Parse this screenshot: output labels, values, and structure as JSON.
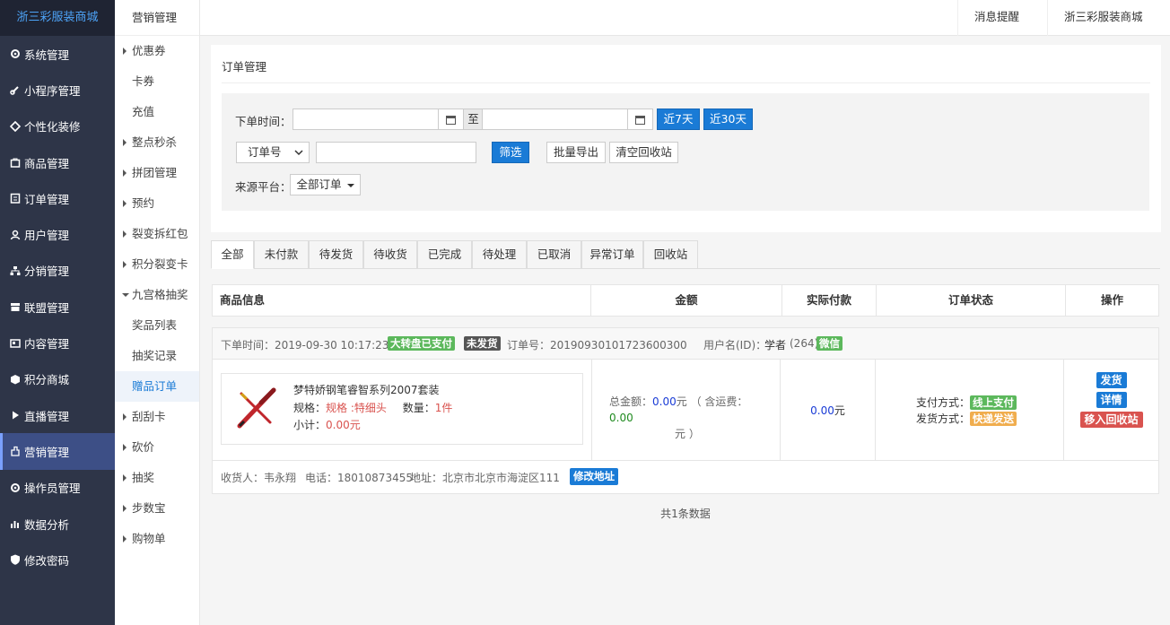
{
  "brand": "浙三彩服装商城",
  "nav": [
    {
      "label": "系统管理",
      "icon": "gear-icon"
    },
    {
      "label": "小程序管理",
      "icon": "link-icon"
    },
    {
      "label": "个性化装修",
      "icon": "diamond-icon"
    },
    {
      "label": "商品管理",
      "icon": "bag-icon"
    },
    {
      "label": "订单管理",
      "icon": "list-icon"
    },
    {
      "label": "用户管理",
      "icon": "user-icon"
    },
    {
      "label": "分销管理",
      "icon": "sitemap-icon"
    },
    {
      "label": "联盟管理",
      "icon": "store-icon"
    },
    {
      "label": "内容管理",
      "icon": "card-icon"
    },
    {
      "label": "积分商城",
      "icon": "cube-icon"
    },
    {
      "label": "直播管理",
      "icon": "play-icon"
    },
    {
      "label": "营销管理",
      "icon": "hand-icon",
      "active": true
    },
    {
      "label": "操作员管理",
      "icon": "gear-icon"
    },
    {
      "label": "数据分析",
      "icon": "bar-chart-icon"
    },
    {
      "label": "修改密码",
      "icon": "shield-icon"
    }
  ],
  "sub": {
    "title": "营销管理",
    "items": [
      {
        "label": "优惠券",
        "type": "arrow"
      },
      {
        "label": "卡券",
        "type": ""
      },
      {
        "label": "充值",
        "type": ""
      },
      {
        "label": "整点秒杀",
        "type": "arrow"
      },
      {
        "label": "拼团管理",
        "type": "arrow"
      },
      {
        "label": "预约",
        "type": "arrow"
      },
      {
        "label": "裂变拆红包",
        "type": "arrow"
      },
      {
        "label": "积分裂变卡",
        "type": "arrow"
      },
      {
        "label": "九宫格抽奖",
        "type": "open"
      },
      {
        "label": "奖品列表",
        "type": ""
      },
      {
        "label": "抽奖记录",
        "type": ""
      },
      {
        "label": "赠品订单",
        "type": "active"
      },
      {
        "label": "刮刮卡",
        "type": "arrow"
      },
      {
        "label": "砍价",
        "type": "arrow"
      },
      {
        "label": "抽奖",
        "type": "arrow"
      },
      {
        "label": "步数宝",
        "type": "arrow"
      },
      {
        "label": "购物单",
        "type": "arrow"
      }
    ]
  },
  "top": {
    "notify": "消息提醒",
    "shop": "浙三彩服装商城"
  },
  "page_title": "订单管理",
  "filter": {
    "time_label": "下单时间：",
    "to": "至",
    "btn_7": "近7天",
    "btn_30": "近30天",
    "select_value": "订单号",
    "btn_filter": "筛选",
    "btn_export": "批量导出",
    "btn_clear": "清空回收站",
    "source_label": "来源平台：",
    "source_value": "全部订单"
  },
  "tabs": [
    "全部",
    "未付款",
    "待发货",
    "待收货",
    "已完成",
    "待处理",
    "已取消",
    "异常订单",
    "回收站"
  ],
  "thead": [
    "商品信息",
    "金额",
    "实际付款",
    "订单状态",
    "操作"
  ],
  "order": {
    "time": "下单时间：2019-09-30 10:17:23",
    "tag1": "大转盘已支付",
    "tag2": "未发货",
    "order_no": "订单号：20190930101723600300",
    "user_label": "用户名(ID)：",
    "user": "学者",
    "uid": "(264)",
    "wechat": "微信",
    "product": "梦特娇钢笔睿智系列2007套装",
    "spec_label": "规格：",
    "spec_value": "规格 :特细头",
    "qty_label": "数量：",
    "qty_value": "1件",
    "subtotal_label": "小计：",
    "subtotal_value": "0.00元",
    "total_label": "总金额：",
    "total_value": "0.00",
    "total_unit": "元",
    "freight_label": "（ 含运费：",
    "freight_value": "0.00",
    "freight_end": "元 ）",
    "paid_value": "0.00",
    "paid_unit": "元",
    "pay_label": "支付方式：",
    "pay_value": "线上支付",
    "ship_label": "发货方式：",
    "ship_value": "快递发送",
    "op_ship": "发货",
    "op_detail": "详情",
    "op_recycle": "移入回收站",
    "receiver": "收货人：韦永翔",
    "phone": "电话：18010873455",
    "address": "地址：北京市北京市海淀区111",
    "edit_addr": "修改地址"
  },
  "total_text": "共1条数据"
}
